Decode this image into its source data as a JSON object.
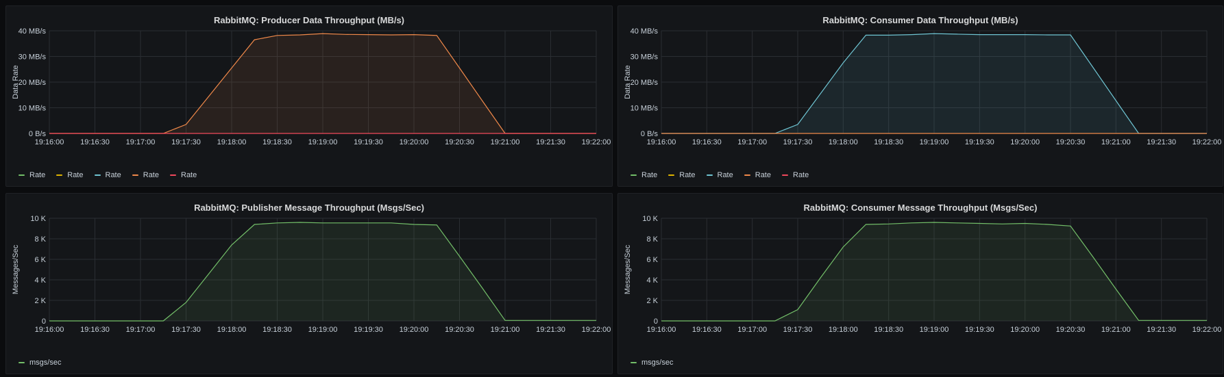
{
  "colors": {
    "green": "#73bf69",
    "yellow": "#e0b400",
    "blue": "#6fc5d3",
    "orange": "#f0894a",
    "red": "#f2495c"
  },
  "chart_data": [
    {
      "type": "area",
      "title": "RabbitMQ: Producer Data Throughput (MB/s)",
      "ylabel": "Data Rate",
      "xlabel": "",
      "x_ticks": [
        "19:16:00",
        "19:16:30",
        "19:17:00",
        "19:17:30",
        "19:18:00",
        "19:18:30",
        "19:19:00",
        "19:19:30",
        "19:20:00",
        "19:20:30",
        "19:21:00",
        "19:21:30",
        "19:22:00"
      ],
      "y_ticks": [
        "0 B/s",
        "10 MB/s",
        "20 MB/s",
        "30 MB/s",
        "40 MB/s"
      ],
      "ylim": [
        0,
        40
      ],
      "grid": true,
      "legend_placement": "bottom-left",
      "legend": [
        "Rate",
        "Rate",
        "Rate",
        "Rate",
        "Rate"
      ],
      "legend_colors": [
        "#73bf69",
        "#e0b400",
        "#6fc5d3",
        "#f0894a",
        "#f2495c"
      ],
      "series": [
        {
          "name": "Rate",
          "color": "#f0894a",
          "fill": true,
          "x": [
            "19:16:00",
            "19:17:15",
            "19:17:30",
            "19:17:45",
            "19:18:00",
            "19:18:15",
            "19:18:30",
            "19:18:45",
            "19:19:00",
            "19:19:15",
            "19:19:30",
            "19:19:45",
            "19:20:00",
            "19:20:15",
            "19:20:30",
            "19:20:45",
            "19:21:00",
            "19:22:00"
          ],
          "values": [
            0,
            0,
            3.5,
            14.5,
            25.5,
            36.5,
            38.2,
            38.4,
            38.9,
            38.6,
            38.5,
            38.4,
            38.5,
            38.2,
            25.5,
            12.7,
            0,
            0
          ]
        },
        {
          "name": "Rate",
          "color": "#f2495c",
          "fill": false,
          "x": [
            "19:16:00",
            "19:22:00"
          ],
          "values": [
            0,
            0
          ]
        }
      ]
    },
    {
      "type": "area",
      "title": "RabbitMQ: Consumer Data Throughput (MB/s)",
      "ylabel": "Data Rate",
      "xlabel": "",
      "x_ticks": [
        "19:16:00",
        "19:16:30",
        "19:17:00",
        "19:17:30",
        "19:18:00",
        "19:18:30",
        "19:19:00",
        "19:19:30",
        "19:20:00",
        "19:20:30",
        "19:21:00",
        "19:21:30",
        "19:22:00"
      ],
      "y_ticks": [
        "0 B/s",
        "10 MB/s",
        "20 MB/s",
        "30 MB/s",
        "40 MB/s"
      ],
      "ylim": [
        0,
        40
      ],
      "grid": true,
      "legend_placement": "bottom-left",
      "legend": [
        "Rate",
        "Rate",
        "Rate",
        "Rate",
        "Rate"
      ],
      "legend_colors": [
        "#73bf69",
        "#e0b400",
        "#6fc5d3",
        "#f0894a",
        "#f2495c"
      ],
      "series": [
        {
          "name": "Rate",
          "color": "#6fc5d3",
          "fill": true,
          "x": [
            "19:16:00",
            "19:17:15",
            "19:17:30",
            "19:17:45",
            "19:18:00",
            "19:18:15",
            "19:18:30",
            "19:18:45",
            "19:19:00",
            "19:19:15",
            "19:19:30",
            "19:19:45",
            "19:20:00",
            "19:20:15",
            "19:20:30",
            "19:20:45",
            "19:21:00",
            "19:21:15",
            "19:22:00"
          ],
          "values": [
            0,
            0,
            3.5,
            15.5,
            27.5,
            38.3,
            38.3,
            38.5,
            38.9,
            38.7,
            38.5,
            38.5,
            38.5,
            38.4,
            38.4,
            25.6,
            12.8,
            0,
            0
          ]
        },
        {
          "name": "Rate",
          "color": "#f0894a",
          "fill": false,
          "x": [
            "19:16:00",
            "19:22:00"
          ],
          "values": [
            0,
            0
          ]
        }
      ]
    },
    {
      "type": "area",
      "title": "RabbitMQ: Publisher Message Throughput (Msgs/Sec)",
      "ylabel": "Messages/Sec",
      "xlabel": "",
      "x_ticks": [
        "19:16:00",
        "19:16:30",
        "19:17:00",
        "19:17:30",
        "19:18:00",
        "19:18:30",
        "19:19:00",
        "19:19:30",
        "19:20:00",
        "19:20:30",
        "19:21:00",
        "19:21:30",
        "19:22:00"
      ],
      "y_ticks": [
        "0",
        "2 K",
        "4 K",
        "6 K",
        "8 K",
        "10 K"
      ],
      "ylim": [
        0,
        10
      ],
      "grid": true,
      "legend_placement": "bottom-left",
      "legend": [
        "msgs/sec"
      ],
      "legend_colors": [
        "#73bf69"
      ],
      "series": [
        {
          "name": "msgs/sec",
          "color": "#73bf69",
          "fill": true,
          "x": [
            "19:16:00",
            "19:17:15",
            "19:17:30",
            "19:17:45",
            "19:18:00",
            "19:18:15",
            "19:18:30",
            "19:18:45",
            "19:19:00",
            "19:19:15",
            "19:19:30",
            "19:19:45",
            "19:20:00",
            "19:20:15",
            "19:20:30",
            "19:20:45",
            "19:21:00",
            "19:22:00"
          ],
          "values": [
            0,
            0,
            1.8,
            4.6,
            7.4,
            9.4,
            9.55,
            9.6,
            9.55,
            9.55,
            9.55,
            9.55,
            9.4,
            9.35,
            6.3,
            3.2,
            0.05,
            0.05
          ]
        }
      ]
    },
    {
      "type": "area",
      "title": "RabbitMQ: Consumer Message Throughput (Msgs/Sec)",
      "ylabel": "Messages/Sec",
      "xlabel": "",
      "x_ticks": [
        "19:16:00",
        "19:16:30",
        "19:17:00",
        "19:17:30",
        "19:18:00",
        "19:18:30",
        "19:19:00",
        "19:19:30",
        "19:20:00",
        "19:20:30",
        "19:21:00",
        "19:21:30",
        "19:22:00"
      ],
      "y_ticks": [
        "0",
        "2 K",
        "4 K",
        "6 K",
        "8 K",
        "10 K"
      ],
      "ylim": [
        0,
        10
      ],
      "grid": true,
      "legend_placement": "bottom-left",
      "legend": [
        "msgs/sec"
      ],
      "legend_colors": [
        "#73bf69"
      ],
      "series": [
        {
          "name": "msgs/sec",
          "color": "#73bf69",
          "fill": true,
          "x": [
            "19:16:00",
            "19:17:15",
            "19:17:30",
            "19:17:45",
            "19:18:00",
            "19:18:15",
            "19:18:30",
            "19:18:45",
            "19:19:00",
            "19:19:15",
            "19:19:30",
            "19:19:45",
            "19:20:00",
            "19:20:15",
            "19:20:30",
            "19:20:45",
            "19:21:00",
            "19:21:15",
            "19:22:00"
          ],
          "values": [
            0,
            0,
            1.1,
            4.2,
            7.2,
            9.4,
            9.45,
            9.55,
            9.6,
            9.55,
            9.5,
            9.45,
            9.5,
            9.4,
            9.25,
            6.2,
            3.1,
            0.05,
            0.05
          ]
        }
      ]
    }
  ]
}
